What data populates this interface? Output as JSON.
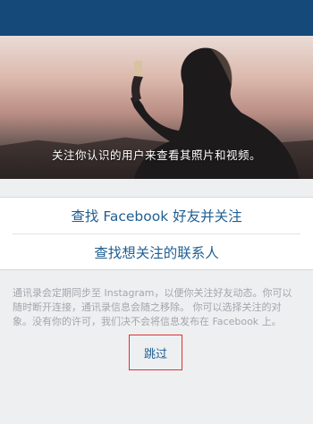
{
  "hero": {
    "caption": "关注你认识的用户来查看其照片和视频。"
  },
  "actions": {
    "find_facebook": "查找 Facebook 好友并关注",
    "find_contacts": "查找想关注的联系人"
  },
  "description": "通讯录会定期同步至 Instagram，以便你关注好友动态。你可以随时断开连接，通讯录信息会随之移除。 你可以选择关注的对象。没有你的许可，我们决不会将信息发布在 Facebook 上。",
  "skip_label": "跳过",
  "colors": {
    "topbar": "#14497a",
    "link": "#1f5e92",
    "highlight": "#e03131",
    "background": "#eeeff1"
  }
}
